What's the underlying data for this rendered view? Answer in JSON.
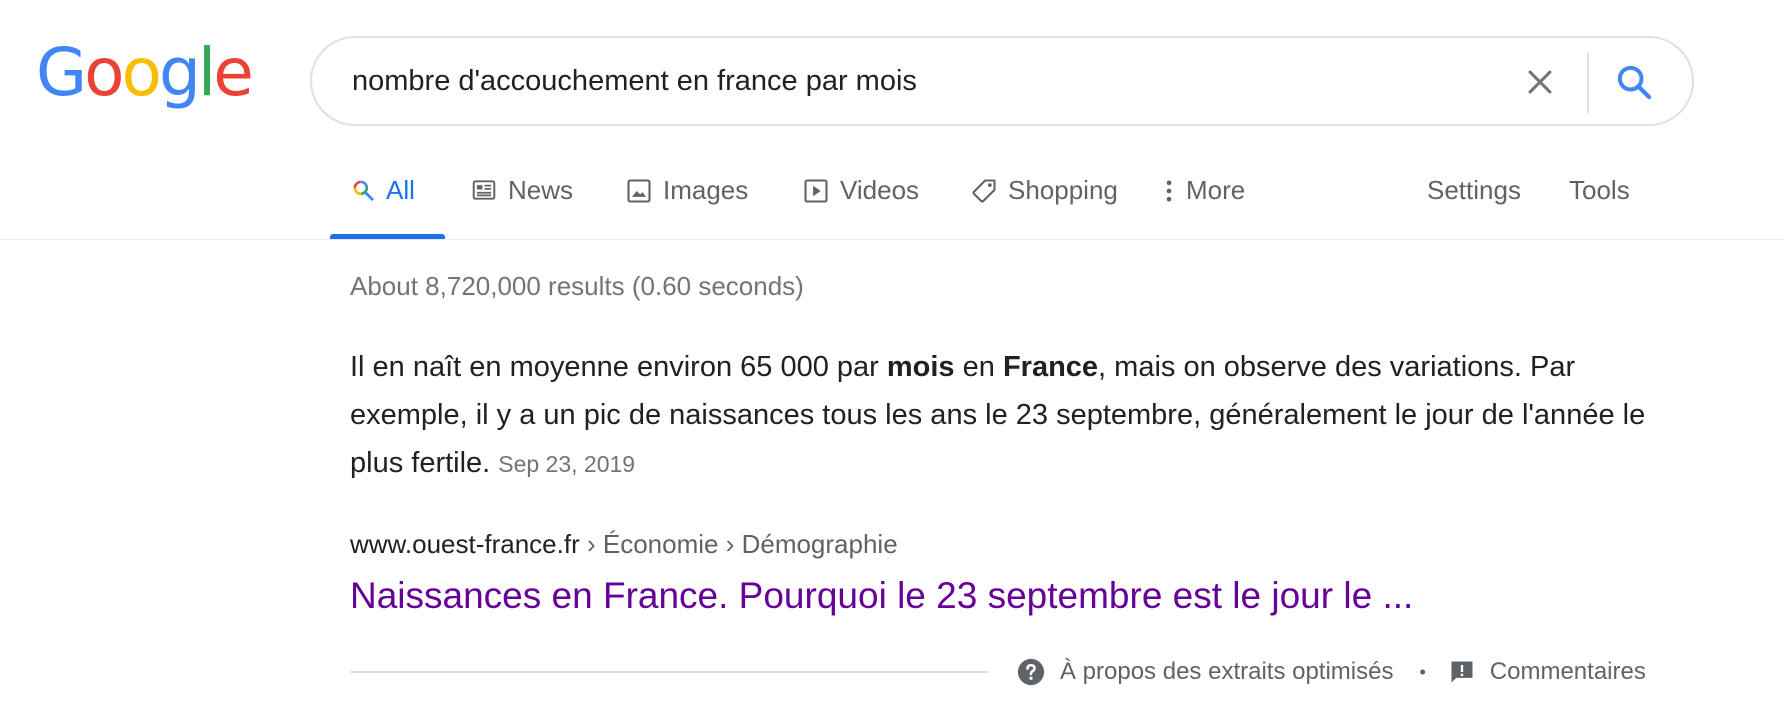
{
  "logo": {
    "letters": [
      "G",
      "o",
      "o",
      "g",
      "l",
      "e"
    ],
    "colors": [
      "#4285f4",
      "#ea4335",
      "#fbbc05",
      "#4285f4",
      "#34a853",
      "#ea4335"
    ]
  },
  "search": {
    "query": "nombre d'accouchement en france par mois"
  },
  "tabs": [
    {
      "label": "All",
      "icon": "search-multicolor-icon"
    },
    {
      "label": "News",
      "icon": "newspaper-icon"
    },
    {
      "label": "Images",
      "icon": "image-icon"
    },
    {
      "label": "Videos",
      "icon": "play-icon"
    },
    {
      "label": "Shopping",
      "icon": "tag-icon"
    },
    {
      "label": "More",
      "icon": "more-vert-icon"
    }
  ],
  "tools": {
    "settings": "Settings",
    "tools": "Tools"
  },
  "stats": "About 8,720,000 results (0.60 seconds)",
  "snippet": {
    "p1": "Il en naît en moyenne environ 65 000 par ",
    "b1": "mois",
    "p2": " en ",
    "b2": "France",
    "p3": ", mais on observe des variations. Par exemple, il y a un pic de naissances tous les ans le 23 septembre, généralement le jour de l'année le plus fertile.",
    "date": "Sep 23, 2019"
  },
  "result": {
    "domain": "www.ouest-france.fr",
    "breadcrumb": " › Économie › Démographie",
    "title": "Naissances en France. Pourquoi le 23 septembre est le jour le ..."
  },
  "footer": {
    "about": "À propos des extraits optimisés",
    "separator": "•",
    "feedback": "Commentaires"
  },
  "colors": {
    "accent": "#1a73e8",
    "visited_link": "#660099",
    "muted": "#70757a"
  }
}
